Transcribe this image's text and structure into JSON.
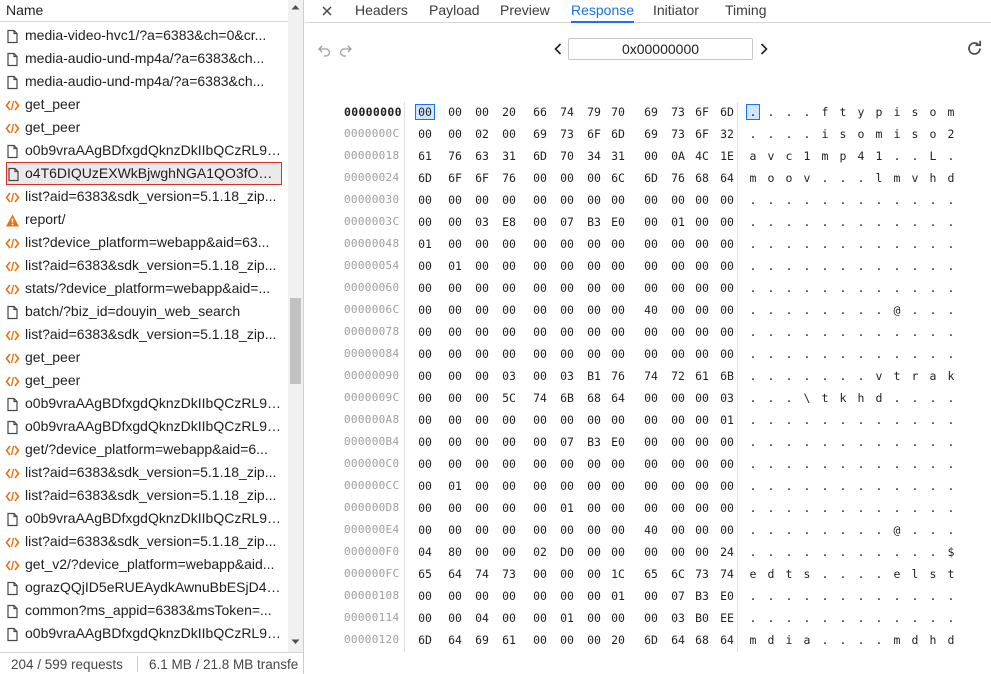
{
  "left": {
    "header": "Name",
    "requests": [
      {
        "label": "media-video-hvc1/?a=6383&ch=0&cr...",
        "icon": "document-icon"
      },
      {
        "label": "media-audio-und-mp4a/?a=6383&ch...",
        "icon": "document-icon"
      },
      {
        "label": "media-audio-und-mp4a/?a=6383&ch...",
        "icon": "document-icon"
      },
      {
        "label": "get_peer",
        "icon": "fetch-icon"
      },
      {
        "label": "get_peer",
        "icon": "fetch-icon"
      },
      {
        "label": "o0b9vraAAgBDfxgdQknzDkIIbQCzRL9y...",
        "icon": "document-icon"
      },
      {
        "label": "o4T6DIQUzEXWkBjwghNGA1QO3fO1P...",
        "icon": "document-icon",
        "selected": true
      },
      {
        "label": "list?aid=6383&sdk_version=5.1.18_zip...",
        "icon": "fetch-icon"
      },
      {
        "label": "report/",
        "icon": "warning-icon"
      },
      {
        "label": "list?device_platform=webapp&aid=63...",
        "icon": "fetch-icon"
      },
      {
        "label": "list?aid=6383&sdk_version=5.1.18_zip...",
        "icon": "fetch-icon"
      },
      {
        "label": "stats/?device_platform=webapp&aid=...",
        "icon": "fetch-icon"
      },
      {
        "label": "batch/?biz_id=douyin_web_search",
        "icon": "document-icon"
      },
      {
        "label": "list?aid=6383&sdk_version=5.1.18_zip...",
        "icon": "fetch-icon"
      },
      {
        "label": "get_peer",
        "icon": "fetch-icon"
      },
      {
        "label": "get_peer",
        "icon": "fetch-icon"
      },
      {
        "label": "o0b9vraAAgBDfxgdQknzDkIIbQCzRL9y...",
        "icon": "document-icon"
      },
      {
        "label": "o0b9vraAAgBDfxgdQknzDkIIbQCzRL9y...",
        "icon": "document-icon"
      },
      {
        "label": "get/?device_platform=webapp&aid=6...",
        "icon": "fetch-icon"
      },
      {
        "label": "list?aid=6383&sdk_version=5.1.18_zip...",
        "icon": "fetch-icon"
      },
      {
        "label": "list?aid=6383&sdk_version=5.1.18_zip...",
        "icon": "fetch-icon"
      },
      {
        "label": "o0b9vraAAgBDfxgdQknzDkIIbQCzRL9y...",
        "icon": "document-icon"
      },
      {
        "label": "list?aid=6383&sdk_version=5.1.18_zip...",
        "icon": "fetch-icon"
      },
      {
        "label": "get_v2/?device_platform=webapp&aid...",
        "icon": "fetch-icon"
      },
      {
        "label": "ograzQQjID5eRUEAydkAwnuBbESjD4a...",
        "icon": "document-icon"
      },
      {
        "label": "common?ms_appid=6383&msToken=...",
        "icon": "document-icon"
      },
      {
        "label": "o0b9vraAAgBDfxgdQknzDkIIbQCzRL9y...",
        "icon": "document-icon"
      }
    ],
    "status": {
      "requests": "204 / 599 requests",
      "size": "6.1 MB / 21.8 MB transfe"
    }
  },
  "tabs": [
    {
      "label": "Headers"
    },
    {
      "label": "Payload"
    },
    {
      "label": "Preview"
    },
    {
      "label": "Response",
      "active": true
    },
    {
      "label": "Initiator"
    },
    {
      "label": "Timing"
    }
  ],
  "toolbar": {
    "address": "0x00000000"
  },
  "colors": {
    "accent": "#1a73e8",
    "selected_outline": "#d93025",
    "fetch_icon": "#e8710a",
    "warning_icon": "#e8710a"
  },
  "hex": {
    "rows": [
      {
        "addr": "00000000",
        "bytes": [
          "00",
          "00",
          "00",
          "20",
          "66",
          "74",
          "79",
          "70",
          "69",
          "73",
          "6F",
          "6D"
        ],
        "chars": [
          ".",
          ".",
          ".",
          ".",
          "f",
          "t",
          "y",
          "p",
          "i",
          "s",
          "o",
          "m"
        ]
      },
      {
        "addr": "0000000C",
        "bytes": [
          "00",
          "00",
          "02",
          "00",
          "69",
          "73",
          "6F",
          "6D",
          "69",
          "73",
          "6F",
          "32"
        ],
        "chars": [
          ".",
          ".",
          ".",
          ".",
          "i",
          "s",
          "o",
          "m",
          "i",
          "s",
          "o",
          "2"
        ]
      },
      {
        "addr": "00000018",
        "bytes": [
          "61",
          "76",
          "63",
          "31",
          "6D",
          "70",
          "34",
          "31",
          "00",
          "0A",
          "4C",
          "1E"
        ],
        "chars": [
          "a",
          "v",
          "c",
          "1",
          "m",
          "p",
          "4",
          "1",
          ".",
          ".",
          "L",
          "."
        ]
      },
      {
        "addr": "00000024",
        "bytes": [
          "6D",
          "6F",
          "6F",
          "76",
          "00",
          "00",
          "00",
          "6C",
          "6D",
          "76",
          "68",
          "64"
        ],
        "chars": [
          "m",
          "o",
          "o",
          "v",
          ".",
          ".",
          ".",
          "l",
          "m",
          "v",
          "h",
          "d"
        ]
      },
      {
        "addr": "00000030",
        "bytes": [
          "00",
          "00",
          "00",
          "00",
          "00",
          "00",
          "00",
          "00",
          "00",
          "00",
          "00",
          "00"
        ],
        "chars": [
          ".",
          ".",
          ".",
          ".",
          ".",
          ".",
          ".",
          ".",
          ".",
          ".",
          ".",
          "."
        ]
      },
      {
        "addr": "0000003C",
        "bytes": [
          "00",
          "00",
          "03",
          "E8",
          "00",
          "07",
          "B3",
          "E0",
          "00",
          "01",
          "00",
          "00"
        ],
        "chars": [
          ".",
          ".",
          ".",
          ".",
          ".",
          ".",
          ".",
          ".",
          ".",
          ".",
          ".",
          "."
        ]
      },
      {
        "addr": "00000048",
        "bytes": [
          "01",
          "00",
          "00",
          "00",
          "00",
          "00",
          "00",
          "00",
          "00",
          "00",
          "00",
          "00"
        ],
        "chars": [
          ".",
          ".",
          ".",
          ".",
          ".",
          ".",
          ".",
          ".",
          ".",
          ".",
          ".",
          "."
        ]
      },
      {
        "addr": "00000054",
        "bytes": [
          "00",
          "01",
          "00",
          "00",
          "00",
          "00",
          "00",
          "00",
          "00",
          "00",
          "00",
          "00"
        ],
        "chars": [
          ".",
          ".",
          ".",
          ".",
          ".",
          ".",
          ".",
          ".",
          ".",
          ".",
          ".",
          "."
        ]
      },
      {
        "addr": "00000060",
        "bytes": [
          "00",
          "00",
          "00",
          "00",
          "00",
          "00",
          "00",
          "00",
          "00",
          "00",
          "00",
          "00"
        ],
        "chars": [
          ".",
          ".",
          ".",
          ".",
          ".",
          ".",
          ".",
          ".",
          ".",
          ".",
          ".",
          "."
        ]
      },
      {
        "addr": "0000006C",
        "bytes": [
          "00",
          "00",
          "00",
          "00",
          "00",
          "00",
          "00",
          "00",
          "40",
          "00",
          "00",
          "00"
        ],
        "chars": [
          ".",
          ".",
          ".",
          ".",
          ".",
          ".",
          ".",
          ".",
          "@",
          ".",
          ".",
          "."
        ]
      },
      {
        "addr": "00000078",
        "bytes": [
          "00",
          "00",
          "00",
          "00",
          "00",
          "00",
          "00",
          "00",
          "00",
          "00",
          "00",
          "00"
        ],
        "chars": [
          ".",
          ".",
          ".",
          ".",
          ".",
          ".",
          ".",
          ".",
          ".",
          ".",
          ".",
          "."
        ]
      },
      {
        "addr": "00000084",
        "bytes": [
          "00",
          "00",
          "00",
          "00",
          "00",
          "00",
          "00",
          "00",
          "00",
          "00",
          "00",
          "00"
        ],
        "chars": [
          ".",
          ".",
          ".",
          ".",
          ".",
          ".",
          ".",
          ".",
          ".",
          ".",
          ".",
          "."
        ]
      },
      {
        "addr": "00000090",
        "bytes": [
          "00",
          "00",
          "00",
          "03",
          "00",
          "03",
          "B1",
          "76",
          "74",
          "72",
          "61",
          "6B"
        ],
        "chars": [
          ".",
          ".",
          ".",
          ".",
          ".",
          ".",
          ".",
          "v",
          "t",
          "r",
          "a",
          "k"
        ]
      },
      {
        "addr": "0000009C",
        "bytes": [
          "00",
          "00",
          "00",
          "5C",
          "74",
          "6B",
          "68",
          "64",
          "00",
          "00",
          "00",
          "03"
        ],
        "chars": [
          ".",
          ".",
          ".",
          "\\",
          "t",
          "k",
          "h",
          "d",
          ".",
          ".",
          ".",
          "."
        ]
      },
      {
        "addr": "000000A8",
        "bytes": [
          "00",
          "00",
          "00",
          "00",
          "00",
          "00",
          "00",
          "00",
          "00",
          "00",
          "00",
          "01"
        ],
        "chars": [
          ".",
          ".",
          ".",
          ".",
          ".",
          ".",
          ".",
          ".",
          ".",
          ".",
          ".",
          "."
        ]
      },
      {
        "addr": "000000B4",
        "bytes": [
          "00",
          "00",
          "00",
          "00",
          "00",
          "07",
          "B3",
          "E0",
          "00",
          "00",
          "00",
          "00"
        ],
        "chars": [
          ".",
          ".",
          ".",
          ".",
          ".",
          ".",
          ".",
          ".",
          ".",
          ".",
          ".",
          "."
        ]
      },
      {
        "addr": "000000C0",
        "bytes": [
          "00",
          "00",
          "00",
          "00",
          "00",
          "00",
          "00",
          "00",
          "00",
          "00",
          "00",
          "00"
        ],
        "chars": [
          ".",
          ".",
          ".",
          ".",
          ".",
          ".",
          ".",
          ".",
          ".",
          ".",
          ".",
          "."
        ]
      },
      {
        "addr": "000000CC",
        "bytes": [
          "00",
          "01",
          "00",
          "00",
          "00",
          "00",
          "00",
          "00",
          "00",
          "00",
          "00",
          "00"
        ],
        "chars": [
          ".",
          ".",
          ".",
          ".",
          ".",
          ".",
          ".",
          ".",
          ".",
          ".",
          ".",
          "."
        ]
      },
      {
        "addr": "000000D8",
        "bytes": [
          "00",
          "00",
          "00",
          "00",
          "00",
          "01",
          "00",
          "00",
          "00",
          "00",
          "00",
          "00"
        ],
        "chars": [
          ".",
          ".",
          ".",
          ".",
          ".",
          ".",
          ".",
          ".",
          ".",
          ".",
          ".",
          "."
        ]
      },
      {
        "addr": "000000E4",
        "bytes": [
          "00",
          "00",
          "00",
          "00",
          "00",
          "00",
          "00",
          "00",
          "40",
          "00",
          "00",
          "00"
        ],
        "chars": [
          ".",
          ".",
          ".",
          ".",
          ".",
          ".",
          ".",
          ".",
          "@",
          ".",
          ".",
          "."
        ]
      },
      {
        "addr": "000000F0",
        "bytes": [
          "04",
          "80",
          "00",
          "00",
          "02",
          "D0",
          "00",
          "00",
          "00",
          "00",
          "00",
          "24"
        ],
        "chars": [
          ".",
          ".",
          ".",
          ".",
          ".",
          ".",
          ".",
          ".",
          ".",
          ".",
          ".",
          "$"
        ]
      },
      {
        "addr": "000000FC",
        "bytes": [
          "65",
          "64",
          "74",
          "73",
          "00",
          "00",
          "00",
          "1C",
          "65",
          "6C",
          "73",
          "74"
        ],
        "chars": [
          "e",
          "d",
          "t",
          "s",
          ".",
          ".",
          ".",
          ".",
          "e",
          "l",
          "s",
          "t"
        ]
      },
      {
        "addr": "00000108",
        "bytes": [
          "00",
          "00",
          "00",
          "00",
          "00",
          "00",
          "00",
          "01",
          "00",
          "07",
          "B3",
          "E0"
        ],
        "chars": [
          ".",
          ".",
          ".",
          ".",
          ".",
          ".",
          ".",
          ".",
          ".",
          ".",
          ".",
          "."
        ]
      },
      {
        "addr": "00000114",
        "bytes": [
          "00",
          "00",
          "04",
          "00",
          "00",
          "01",
          "00",
          "00",
          "00",
          "03",
          "B0",
          "EE"
        ],
        "chars": [
          ".",
          ".",
          ".",
          ".",
          ".",
          ".",
          ".",
          ".",
          ".",
          ".",
          ".",
          "."
        ]
      },
      {
        "addr": "00000120",
        "bytes": [
          "6D",
          "64",
          "69",
          "61",
          "00",
          "00",
          "00",
          "20",
          "6D",
          "64",
          "68",
          "64"
        ],
        "chars": [
          "m",
          "d",
          "i",
          "a",
          ".",
          ".",
          ".",
          ".",
          "m",
          "d",
          "h",
          "d"
        ]
      }
    ]
  }
}
